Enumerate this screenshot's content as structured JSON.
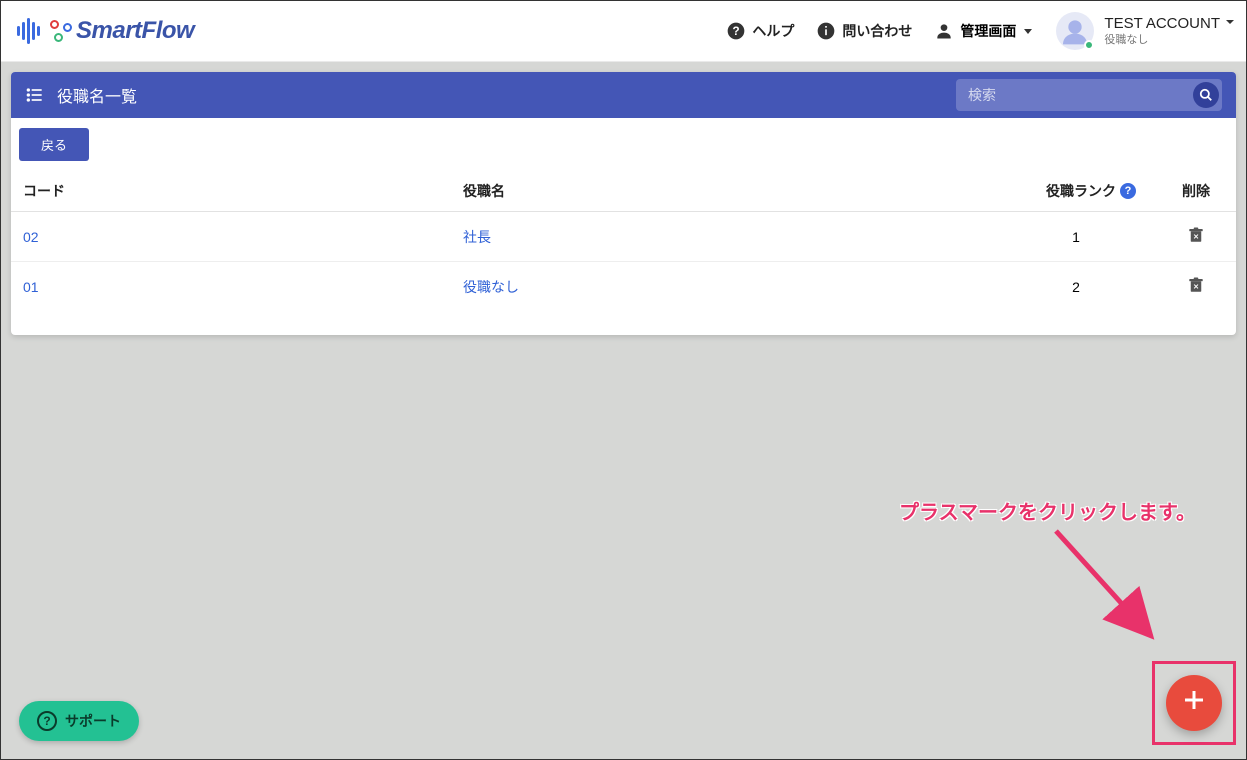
{
  "brand": {
    "name": "SmartFlow"
  },
  "header": {
    "help": "ヘルプ",
    "contact": "問い合わせ",
    "admin": "管理画面"
  },
  "account": {
    "name": "TEST ACCOUNT",
    "role": "役職なし"
  },
  "panel": {
    "title": "役職名一覧",
    "search_placeholder": "検索",
    "back": "戻る"
  },
  "table": {
    "headers": {
      "code": "コード",
      "name": "役職名",
      "rank": "役職ランク",
      "delete": "削除"
    },
    "rows": [
      {
        "code": "02",
        "name": "社長",
        "rank": "1"
      },
      {
        "code": "01",
        "name": "役職なし",
        "rank": "2"
      }
    ]
  },
  "support": {
    "label": "サポート"
  },
  "callout": {
    "text": "プラスマークをクリックします。"
  }
}
